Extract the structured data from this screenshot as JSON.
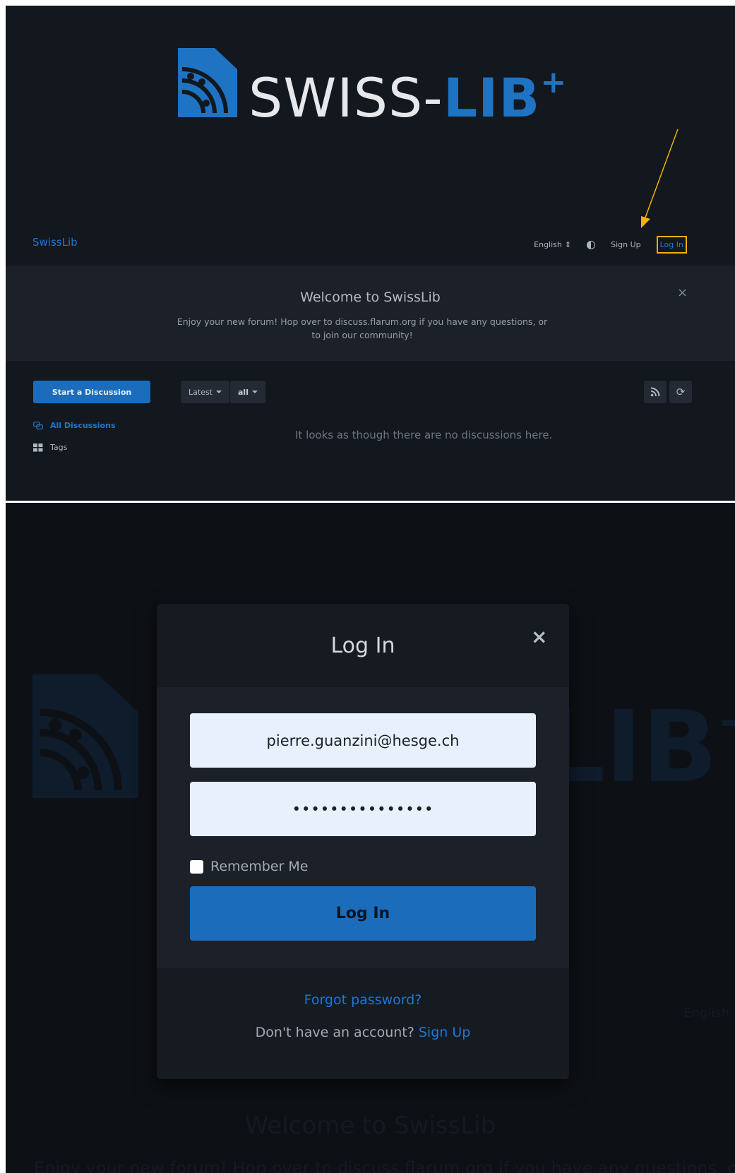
{
  "logo": {
    "text_main": "SWISS-",
    "text_strong": "LIB",
    "text_sup": "+"
  },
  "nav": {
    "brand": "SwissLib",
    "language": "English",
    "signup": "Sign Up",
    "login": "Log In"
  },
  "hero": {
    "title": "Welcome to SwissLib",
    "description": "Enjoy your new forum! Hop over to discuss.flarum.org if you have any questions, or to join our community!",
    "close": "×"
  },
  "toolbar": {
    "start_discussion": "Start a Discussion",
    "sort": "Latest",
    "filter": "all"
  },
  "sidebar": {
    "items": [
      {
        "label": "All Discussions"
      },
      {
        "label": "Tags"
      }
    ]
  },
  "main": {
    "empty_message": "It looks as though there are no discussions here."
  },
  "modal": {
    "title": "Log In",
    "close": "×",
    "email_value": "pierre.guanzini@hesge.ch",
    "password_value": "•••••••••••••••",
    "remember_label": "Remember Me",
    "submit_label": "Log In",
    "forgot_label": "Forgot password?",
    "no_account_text": "Don't have an account? ",
    "signup_link": "Sign Up"
  },
  "background": {
    "logo_text": "LIB",
    "logo_sup": "+",
    "language": "English",
    "welcome": "Welcome to SwissLib",
    "description": "Enjoy your new forum! Hop over to discuss.flarum.org if you have any questions, or to join"
  },
  "colors": {
    "accent": "#1f78d1",
    "highlight": "#f3b200",
    "panel_bg": "#13171e"
  }
}
